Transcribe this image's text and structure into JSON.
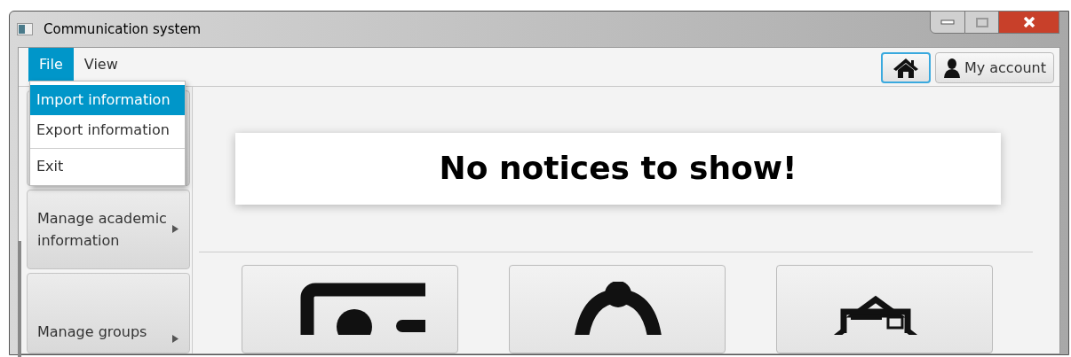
{
  "window": {
    "title": "Communication system"
  },
  "menu_bar": [
    {
      "label": "File",
      "selected": true
    },
    {
      "label": "View",
      "selected": false
    }
  ],
  "open_menu": {
    "groups": [
      [
        {
          "label": "Import information",
          "selected": true
        },
        {
          "label": "Export information",
          "selected": false
        }
      ],
      [
        {
          "label": "Exit",
          "selected": false
        }
      ]
    ]
  },
  "toolbar": {
    "home_focused": true,
    "account_label": "My account"
  },
  "sidebar": {
    "items": [
      {
        "label": "Manage academic information"
      },
      {
        "label": "Manage groups"
      }
    ]
  },
  "notice": "No notices to show!",
  "tiles": [
    {
      "kind": "id-card"
    },
    {
      "kind": "bell"
    },
    {
      "kind": "mail"
    }
  ]
}
